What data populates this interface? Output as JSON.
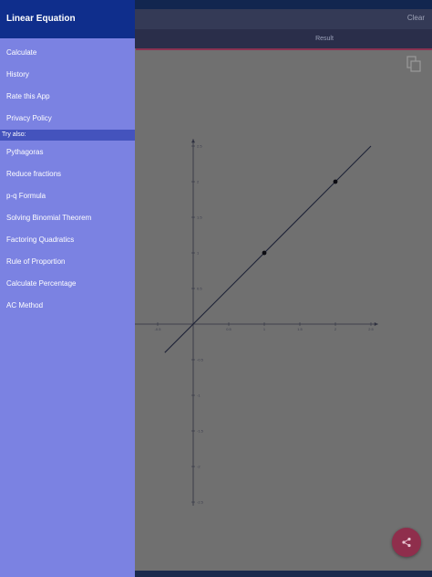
{
  "toolbar": {
    "clear_label": "Clear"
  },
  "tabs": {
    "result_label": "Result"
  },
  "drawer": {
    "title": "Linear Equation",
    "items": [
      "Calculate",
      "History",
      "Rate this App",
      "Privacy Policy"
    ],
    "section_label": "Try also:",
    "try_also": [
      "Pythagoras",
      "Reduce fractions",
      "p-q Formula",
      "Solving Binomial Theorem",
      "Factoring Quadratics",
      "Rule of Proportion",
      "Calculate Percentage",
      "AC Method"
    ]
  },
  "icons": {
    "copy": "copy-icon",
    "share": "share-icon"
  },
  "colors": {
    "drawer_bg": "#7b82e2",
    "drawer_header": "#0f2e8c",
    "section_bg": "#4453bd",
    "fab": "#8f2e4c",
    "accent_line": "#8a3352"
  },
  "chart_data": {
    "type": "line",
    "title": "",
    "xlabel": "",
    "ylabel": "",
    "xlim": [
      -1,
      2.5
    ],
    "ylim": [
      -2.5,
      2.5
    ],
    "x_ticks": [
      -1,
      -0.5,
      0.5,
      1,
      1.5,
      2,
      2.5
    ],
    "y_ticks": [
      2.5,
      2,
      1.5,
      1,
      0.5,
      -0.5,
      -1,
      -1.5,
      -2,
      -2.5
    ],
    "line": {
      "x": [
        -0.4,
        2.5
      ],
      "y": [
        -0.4,
        2.5
      ]
    },
    "points": [
      {
        "x": 1,
        "y": 1
      },
      {
        "x": 2,
        "y": 2
      }
    ]
  }
}
